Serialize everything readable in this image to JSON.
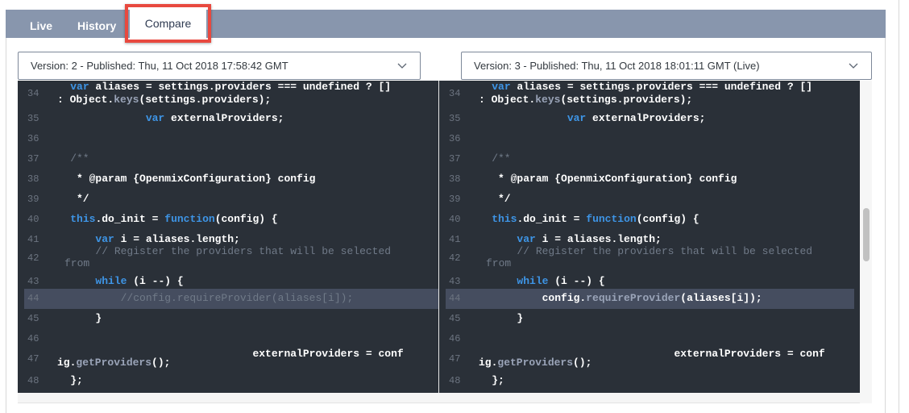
{
  "tabs": [
    {
      "label": "Live",
      "active": false
    },
    {
      "label": "History",
      "active": false
    },
    {
      "label": "Compare",
      "active": true
    }
  ],
  "compare": {
    "left_version": "Version: 2 - Published: Thu, 11 Oct 2018 17:58:42 GMT",
    "right_version": "Version: 3 - Published: Thu, 11 Oct 2018 18:01:11 GMT (Live)"
  },
  "highlight_color": "#e8493f",
  "left_pane": {
    "lines": [
      {
        "n": "34",
        "a": "    var aliases = settings.providers === undefined ? []",
        "b": ": Object.keys(settings.providers);"
      },
      {
        "n": "35",
        "a": "                var externalProviders;"
      },
      {
        "n": "36",
        "a": ""
      },
      {
        "n": "37",
        "a": "    /**"
      },
      {
        "n": "38",
        "a": "     * @param {OpenmixConfiguration} config"
      },
      {
        "n": "39",
        "a": "     */"
      },
      {
        "n": "40",
        "a": "    this.do_init = function(config) {"
      },
      {
        "n": "41",
        "a": "        var i = aliases.length;"
      },
      {
        "n": "42",
        "a": "        // Register the providers that will be selected",
        "b": "from"
      },
      {
        "n": "43",
        "a": "        while (i --) {"
      },
      {
        "n": "44",
        "a": "            //config.requireProvider(aliases[i]);"
      },
      {
        "n": "45",
        "a": "        }"
      },
      {
        "n": "46",
        "a": ""
      },
      {
        "n": "47",
        "a": "                                 externalProviders = conf",
        "b": "ig.getProviders();"
      },
      {
        "n": "48",
        "a": "    };"
      }
    ]
  },
  "right_pane": {
    "lines": [
      {
        "n": "34",
        "a": "    var aliases = settings.providers === undefined ? []",
        "b": ": Object.keys(settings.providers);"
      },
      {
        "n": "35",
        "a": "                var externalProviders;"
      },
      {
        "n": "36",
        "a": ""
      },
      {
        "n": "37",
        "a": "    /**"
      },
      {
        "n": "38",
        "a": "     * @param {OpenmixConfiguration} config"
      },
      {
        "n": "39",
        "a": "     */"
      },
      {
        "n": "40",
        "a": "    this.do_init = function(config) {"
      },
      {
        "n": "41",
        "a": "        var i = aliases.length;"
      },
      {
        "n": "42",
        "a": "        // Register the providers that will be selected",
        "b": "from"
      },
      {
        "n": "43",
        "a": "        while (i --) {"
      },
      {
        "n": "44",
        "a": "            config.requireProvider(aliases[i]);"
      },
      {
        "n": "45",
        "a": "        }"
      },
      {
        "n": "46",
        "a": ""
      },
      {
        "n": "47",
        "a": "                                 externalProviders = conf",
        "b": "ig.getProviders();"
      },
      {
        "n": "48",
        "a": "    };"
      }
    ]
  }
}
